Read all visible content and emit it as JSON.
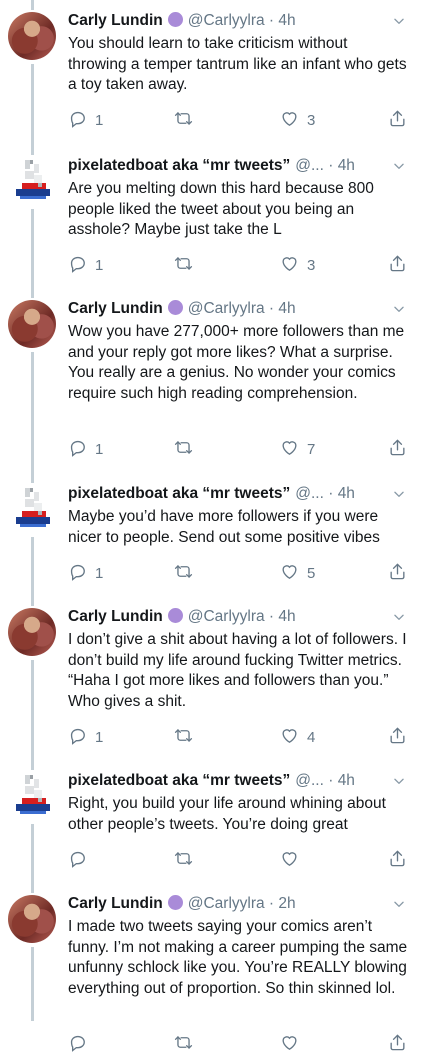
{
  "tweets": [
    {
      "name": "Carly Lundin",
      "verified": true,
      "handle": "@Carlyylra",
      "time": "4h",
      "text": "You should learn to take criticism without throwing a temper tantrum like an infant who gets a toy taken away.",
      "replies": "1",
      "retweets": "",
      "likes": "3"
    },
    {
      "name": "pixelatedboat aka “mr tweets”",
      "verified": false,
      "handle": "@...",
      "time": "4h",
      "text": "Are you melting down this hard because 800 people liked the tweet about you being an asshole? Maybe just take the L",
      "replies": "1",
      "retweets": "",
      "likes": "3"
    },
    {
      "name": "Carly Lundin",
      "verified": true,
      "handle": "@Carlyylra",
      "time": "4h",
      "text": "Wow you have 277,000+ more followers than me and your reply got more likes? What a surprise. You really are a genius. No wonder your comics require such high reading comprehension.",
      "replies": "1",
      "retweets": "",
      "likes": "7"
    },
    {
      "name": "pixelatedboat aka “mr tweets”",
      "verified": false,
      "handle": "@...",
      "time": "4h",
      "text": "Maybe you’d have more followers if you were nicer to people. Send out some positive vibes",
      "replies": "1",
      "retweets": "",
      "likes": "5"
    },
    {
      "name": "Carly Lundin",
      "verified": true,
      "handle": "@Carlyylra",
      "time": "4h",
      "text": "I don’t give a shit about having a lot of followers. I don’t build my life around fucking Twitter metrics. “Haha I got more likes and followers than you.” Who gives a shit.",
      "replies": "1",
      "retweets": "",
      "likes": "4"
    },
    {
      "name": "pixelatedboat aka “mr tweets”",
      "verified": false,
      "handle": "@...",
      "time": "4h",
      "text": "Right, you build your life around whining about other people’s tweets. You’re doing great",
      "replies": "",
      "retweets": "",
      "likes": ""
    },
    {
      "name": "Carly Lundin",
      "verified": true,
      "handle": "@Carlyylra",
      "time": "2h",
      "text": "I made two tweets saying your comics aren’t funny. I’m not making a career pumping the same unfunny schlock like you. You’re REALLY blowing everything out of proportion. So thin skinned lol.",
      "replies": "",
      "retweets": "",
      "likes": ""
    }
  ],
  "colors": {
    "text": "#14171a",
    "secondary": "#657786",
    "thread_line": "#c4cfd6",
    "verified_badge": "#a98bd8"
  },
  "icons": {
    "reply": "reply-icon",
    "retweet": "retweet-icon",
    "like": "heart-icon",
    "share": "share-icon",
    "menu": "chevron-down-icon"
  }
}
